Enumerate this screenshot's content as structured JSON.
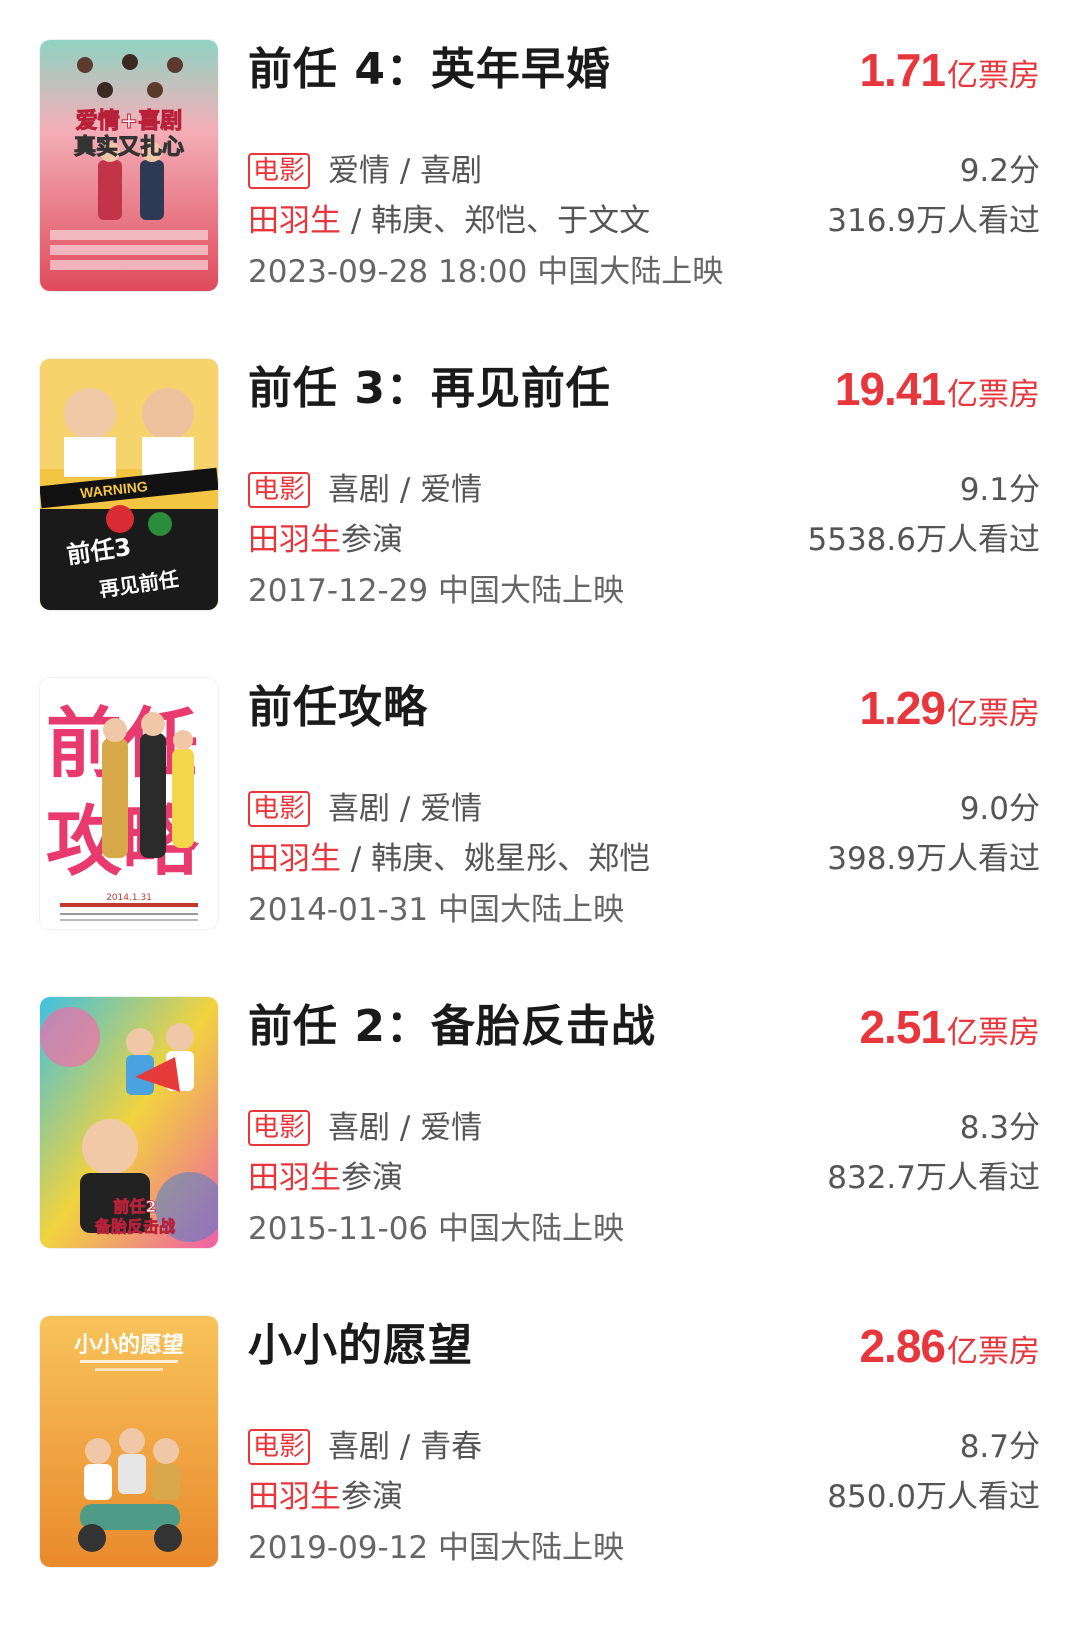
{
  "movies": [
    {
      "title": "前任 4：英年早婚",
      "box_office_value": "1.71",
      "box_office_unit": "亿票房",
      "type_badge": "电影",
      "genre": "爱情 / 喜剧",
      "director": "田羽生",
      "cast": " / 韩庚、郑恺、于文文",
      "release": "2023-09-28 18:00 中国大陆上映",
      "score": "9.2分",
      "viewers": "316.9万人看过",
      "poster_lines": [
        "爱情+喜剧",
        "真实又扎心"
      ],
      "poster_colors": [
        "#f4a3ad",
        "#e05365"
      ]
    },
    {
      "title": "前任 3：再见前任",
      "box_office_value": "19.41",
      "box_office_unit": "亿票房",
      "type_badge": "电影",
      "genre": "喜剧 / 爱情",
      "director": "田羽生",
      "cast": "参演",
      "release": "2017-12-29 中国大陆上映",
      "score": "9.1分",
      "viewers": "5538.6万人看过",
      "poster_lines": [
        "前任3",
        "再见前任"
      ],
      "poster_colors": [
        "#f2c33c",
        "#1b1b1b"
      ]
    },
    {
      "title": "前任攻略",
      "box_office_value": "1.29",
      "box_office_unit": "亿票房",
      "type_badge": "电影",
      "genre": "喜剧 / 爱情",
      "director": "田羽生",
      "cast": " / 韩庚、姚星彤、郑恺",
      "release": "2014-01-31 中国大陆上映",
      "score": "9.0分",
      "viewers": "398.9万人看过",
      "poster_lines": [
        "前任",
        "攻略"
      ],
      "poster_colors": [
        "#ffffff",
        "#e83a6e"
      ]
    },
    {
      "title": "前任 2：备胎反击战",
      "box_office_value": "2.51",
      "box_office_unit": "亿票房",
      "type_badge": "电影",
      "genre": "喜剧 / 爱情",
      "director": "田羽生",
      "cast": "参演",
      "release": "2015-11-06 中国大陆上映",
      "score": "8.3分",
      "viewers": "832.7万人看过",
      "poster_lines": [
        "前任2",
        "备胎反击战"
      ],
      "poster_colors": [
        "#f07ab3",
        "#3a7fd6"
      ]
    },
    {
      "title": "小小的愿望",
      "box_office_value": "2.86",
      "box_office_unit": "亿票房",
      "type_badge": "电影",
      "genre": "喜剧 / 青春",
      "director": "田羽生",
      "cast": "参演",
      "release": "2019-09-12 中国大陆上映",
      "score": "8.7分",
      "viewers": "850.0万人看过",
      "poster_lines": [
        "小小的愿望"
      ],
      "poster_colors": [
        "#f6b24a",
        "#e98a2c"
      ]
    }
  ],
  "colors": {
    "accent": "#e8363d",
    "title": "#1a1a1a",
    "meta": "#555555"
  }
}
